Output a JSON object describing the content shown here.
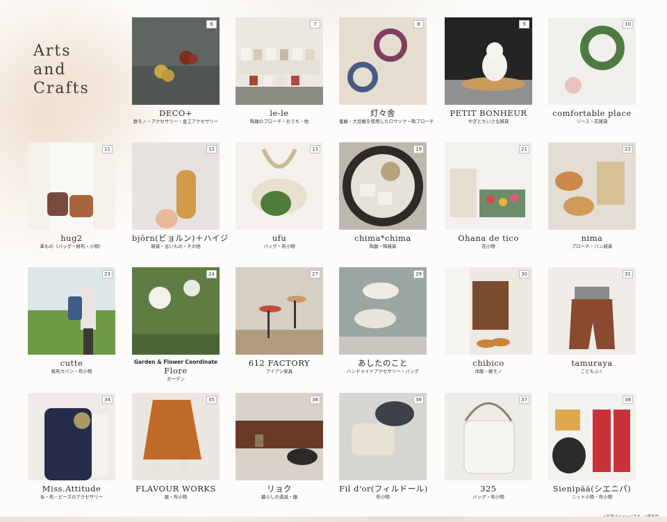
{
  "heading": [
    "Arts",
    "and",
    "Crafts"
  ],
  "footnote": "※写真はイメージです。※順不同",
  "cards": [
    {
      "num": "6",
      "name": "DECO+",
      "sub": "鉄モノ・アクセサリー・金工アクセサリー"
    },
    {
      "num": "7",
      "name": "le-le",
      "sub": "陶器のブローチ・おうち・他"
    },
    {
      "num": "8",
      "name": "灯々舎",
      "sub": "蜜蝋・大豆蝋を使用したロウソク・陶ブローチ"
    },
    {
      "num": "9",
      "name": "PETIT BONHEUR",
      "sub": "やぎとちいさな雑貨"
    },
    {
      "num": "10",
      "name": "comfortable place",
      "sub": "リース・花雑貨"
    },
    {
      "num": "11",
      "name": "hug2",
      "sub": "革もの（バッグ・財布・小物）"
    },
    {
      "num": "12",
      "name": "bjōrn(ビョルン)＋ハイジ",
      "sub": "雑貨・古いもの・その他"
    },
    {
      "num": "13",
      "name": "ufu",
      "sub": "バッグ・布小物"
    },
    {
      "num": "19",
      "name": "chima*chima",
      "sub": "陶器・陶雑貨"
    },
    {
      "num": "21",
      "name": "Ohana de tico",
      "sub": "花小物"
    },
    {
      "num": "22",
      "name": "nima",
      "sub": "ブローチ・パン雑貨"
    },
    {
      "num": "23",
      "name": "cutte",
      "sub": "帆布カバン・布小物"
    },
    {
      "num": "24",
      "pre": "Garden & Flower Coordinate",
      "name": "Flore",
      "sub": "ガーデン"
    },
    {
      "num": "27",
      "name": "612 FACTORY",
      "sub": "アイアン家具"
    },
    {
      "num": "29",
      "name": "あしたのこと",
      "sub": "ハンドメイドアクセサリー・バッグ"
    },
    {
      "num": "30",
      "name": "chibico",
      "sub": "洋服・紙モノ"
    },
    {
      "num": "31",
      "name": "tamuraya",
      "sub": "こどもふく"
    },
    {
      "num": "34",
      "name": "Miss.Attitude",
      "sub": "糸・布・ビーズのアクセサリー"
    },
    {
      "num": "35",
      "name": "FLAVOUR WORKS",
      "sub": "服・布小物"
    },
    {
      "num": "36",
      "name": "リョク",
      "sub": "暮らしの道具・器"
    },
    {
      "num": "36",
      "name": "Fil d'or(フィルドール)",
      "sub": "布小物"
    },
    {
      "num": "37",
      "name": "325",
      "sub": "バッグ・布小物"
    },
    {
      "num": "38",
      "name": "Sienipää(シエニパ)",
      "sub": "ニット小物・布小物"
    }
  ],
  "colors": {
    "background": "#fdfcfa",
    "heading": "#3a3836",
    "text": "#2a2522"
  }
}
